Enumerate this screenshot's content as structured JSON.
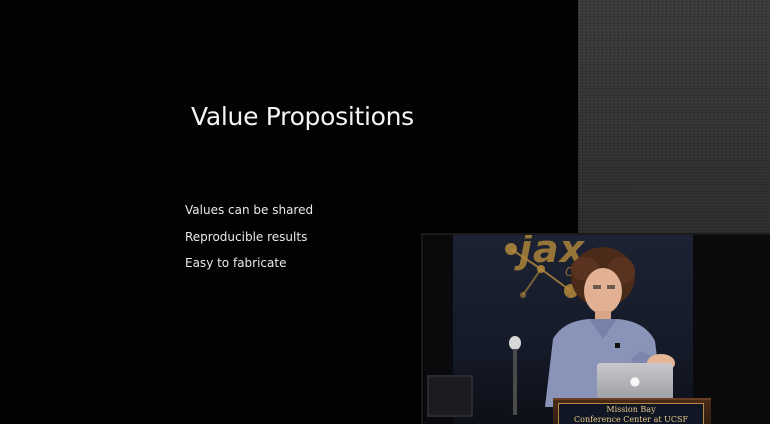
{
  "slide": {
    "title": "Value Propositions",
    "bullets": [
      "Values can be shared",
      "Reproducible results",
      "Easy to fabricate"
    ]
  },
  "video": {
    "backdrop_logo": "jax",
    "backdrop_sub": "Conf",
    "podium_sign": {
      "line1": "Mission Bay",
      "line2": "Conference Center at UCSF"
    },
    "laptop_logo_icon": "apple-logo-icon"
  },
  "colors": {
    "slide_background": "#020202",
    "slide_text": "#f4f4f4",
    "texture_gray": "#2c2c2c",
    "podium_gold": "#e6c98a",
    "speaker_shirt": "#8a93b8"
  }
}
